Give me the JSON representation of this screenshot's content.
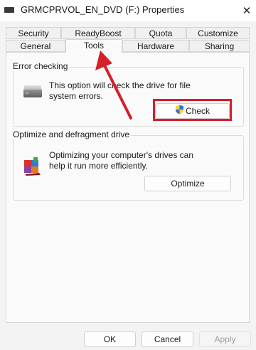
{
  "window": {
    "title": "GRMCPRVOL_EN_DVD (F:) Properties",
    "close_glyph": "✕"
  },
  "tabs": {
    "top_row": [
      "Security",
      "ReadyBoost",
      "Quota",
      "Customize"
    ],
    "bottom_row": [
      "General",
      "Tools",
      "Hardware",
      "Sharing"
    ],
    "active": "Tools"
  },
  "error_checking": {
    "title": "Error checking",
    "description": "This option will check the drive for file system errors.",
    "button": "Check"
  },
  "optimize": {
    "title": "Optimize and defragment drive",
    "description": "Optimizing your computer's drives can help it run more efficiently.",
    "button": "Optimize"
  },
  "footer": {
    "ok": "OK",
    "cancel": "Cancel",
    "apply": "Apply"
  },
  "colors": {
    "annotation_red": "#d4202a",
    "accent": "#0067c0"
  },
  "icons": [
    "drive-icon",
    "shield-icon",
    "defrag-icon",
    "close-icon"
  ]
}
